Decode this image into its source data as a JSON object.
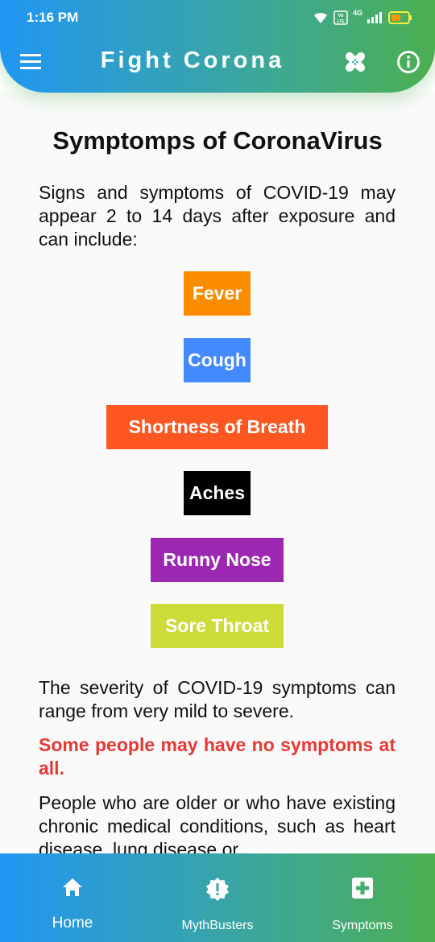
{
  "status_bar": {
    "time": "1:16 PM",
    "network": "4G",
    "volte": "Vo LTE"
  },
  "app_bar": {
    "title": "Fight Corona",
    "menu_icon": "hamburger-menu-icon",
    "bandage_icon": "bandage-icon",
    "info_icon": "info-icon"
  },
  "page": {
    "title": "Symptomps of CoronaVirus",
    "intro": "Signs and symptoms of COVID-19 may appear 2 to 14 days after exposure and can include:",
    "symptoms": [
      {
        "label": "Fever",
        "color": "#fb8c00"
      },
      {
        "label": "Cough",
        "color": "#448aff"
      },
      {
        "label": "Shortness of Breath",
        "color": "#ff5722"
      },
      {
        "label": "Aches",
        "color": "#000000"
      },
      {
        "label": "Runny Nose",
        "color": "#9c27b0"
      },
      {
        "label": "Sore Throat",
        "color": "#cddc39"
      }
    ],
    "severity": "The severity of COVID-19 symptoms can range from very mild to severe.",
    "warning": "Some people may have no symptoms at all.",
    "older": "People who are older or who have existing chronic medical conditions, such as heart disease, lung disease or"
  },
  "bottom_nav": {
    "items": [
      {
        "label": "Home",
        "icon": "home-icon"
      },
      {
        "label": "MythBusters",
        "icon": "alert-badge-icon"
      },
      {
        "label": "Symptoms",
        "icon": "medical-cross-icon"
      }
    ]
  },
  "colors": {
    "gradient_start": "#2196f3",
    "gradient_end": "#4caf50",
    "warning": "#e53935"
  }
}
